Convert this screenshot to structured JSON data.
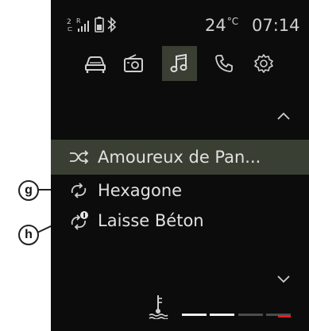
{
  "status": {
    "temperature_value": "24",
    "temperature_unit": "°C",
    "time": "07:14",
    "icons": [
      "sim-icon",
      "signal-icon",
      "phone-battery-icon",
      "bluetooth-icon"
    ]
  },
  "tabs": [
    {
      "name": "car-icon",
      "active": false
    },
    {
      "name": "radio-icon",
      "active": false
    },
    {
      "name": "music-icon",
      "active": true
    },
    {
      "name": "phone-icon",
      "active": false
    },
    {
      "name": "settings-gear-icon",
      "active": false
    }
  ],
  "tracks": [
    {
      "title": "Amoureux de Pan...",
      "icon": "shuffle-icon",
      "selected": true
    },
    {
      "title": "Hexagone",
      "icon": "repeat-icon",
      "selected": false
    },
    {
      "title": "Laisse Béton",
      "icon": "repeat-one-icon",
      "selected": false
    }
  ],
  "callouts": {
    "g": "g",
    "h": "h"
  },
  "coolant": {
    "icon": "coolant-temperature-icon",
    "segments_lit": 2,
    "segments_total": 4,
    "alert_color": "#e02020"
  },
  "colors": {
    "background": "#0c0c0c",
    "highlight": "#3a3f33",
    "text": "#e0e0e0"
  }
}
